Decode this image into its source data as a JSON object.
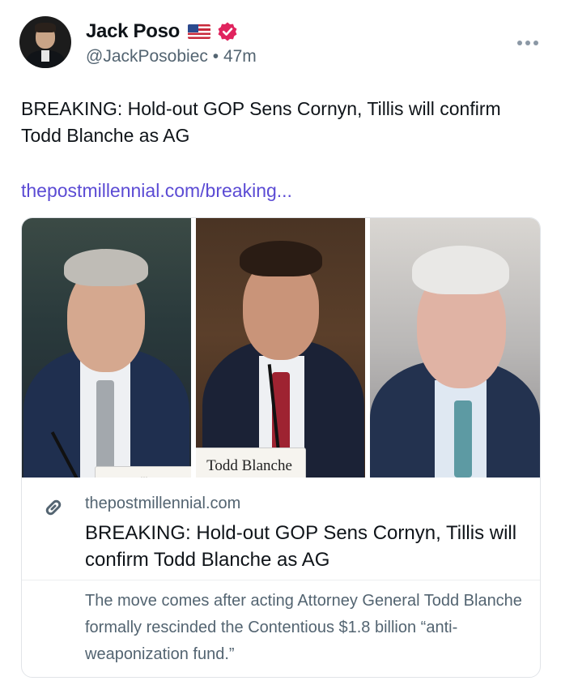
{
  "author": {
    "name": "Jack Poso",
    "handle": "@JackPosobiec",
    "separator": "•",
    "time": "47m",
    "flag_icon": "us-flag-icon",
    "verified_icon": "verified-badge-icon",
    "verified_color": "#e0245e"
  },
  "post": {
    "text": "BREAKING: Hold-out GOP Sens Cornyn, Tillis will confirm Todd Blanche as AG",
    "link_text": "thepostmillennial.com/breaking...",
    "link_color": "#5b4bd4"
  },
  "card": {
    "nameplate_left": "...",
    "nameplate_center": "Todd Blanche",
    "domain": "thepostmillennial.com",
    "title": "BREAKING: Hold-out GOP Sens Cornyn, Tillis will confirm Todd Blanche as AG",
    "description": "The move comes after acting Attorney General Todd Blanche formally rescinded the Contentious $1.8 billion “anti-weaponization fund.”",
    "link_icon": "link-icon"
  },
  "menu": {
    "icon": "more-options-icon"
  }
}
